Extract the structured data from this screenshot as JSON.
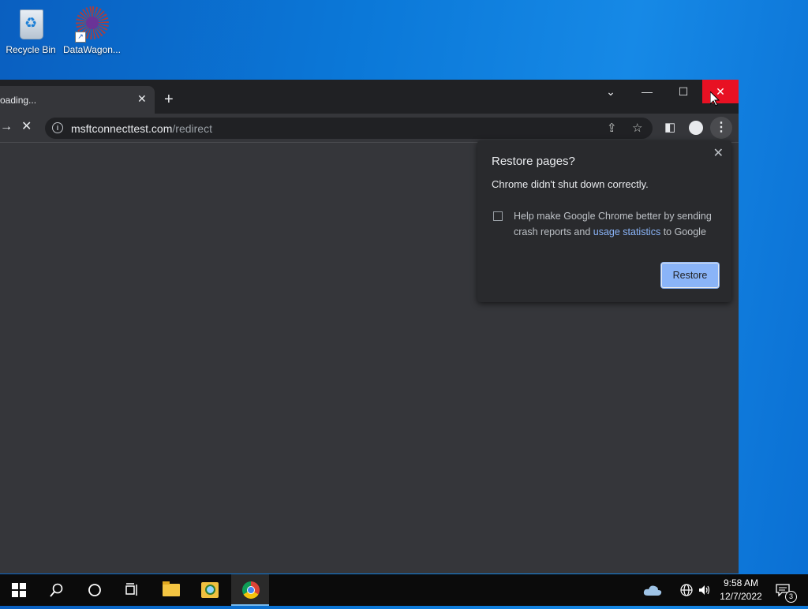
{
  "desktop": {
    "icons": [
      {
        "label": "Recycle Bin"
      },
      {
        "label": "DataWagon..."
      }
    ]
  },
  "browser": {
    "tab": {
      "title": "oading...",
      "close": "✕"
    },
    "new_tab": "+",
    "window_controls": {
      "dropdown": "⌄",
      "minimize": "—",
      "maximize": "☐",
      "close": "✕"
    },
    "toolbar": {
      "forward": "→",
      "stop": "✕",
      "url_host": "msftconnecttest.com",
      "url_path": "/redirect"
    },
    "restore_bubble": {
      "title": "Restore pages?",
      "message": "Chrome didn't shut down correctly.",
      "help_text_1": "Help make Google Chrome better by sending crash reports and ",
      "help_link": "usage statistics",
      "help_text_2": " to Google",
      "restore_label": "Restore",
      "close": "✕"
    }
  },
  "taskbar": {
    "clock_time": "9:58 AM",
    "clock_date": "12/7/2022",
    "notification_count": "3"
  },
  "colors": {
    "close_red": "#e81123",
    "accent_blue": "#8ab4f8",
    "dark_bg": "#202124"
  }
}
